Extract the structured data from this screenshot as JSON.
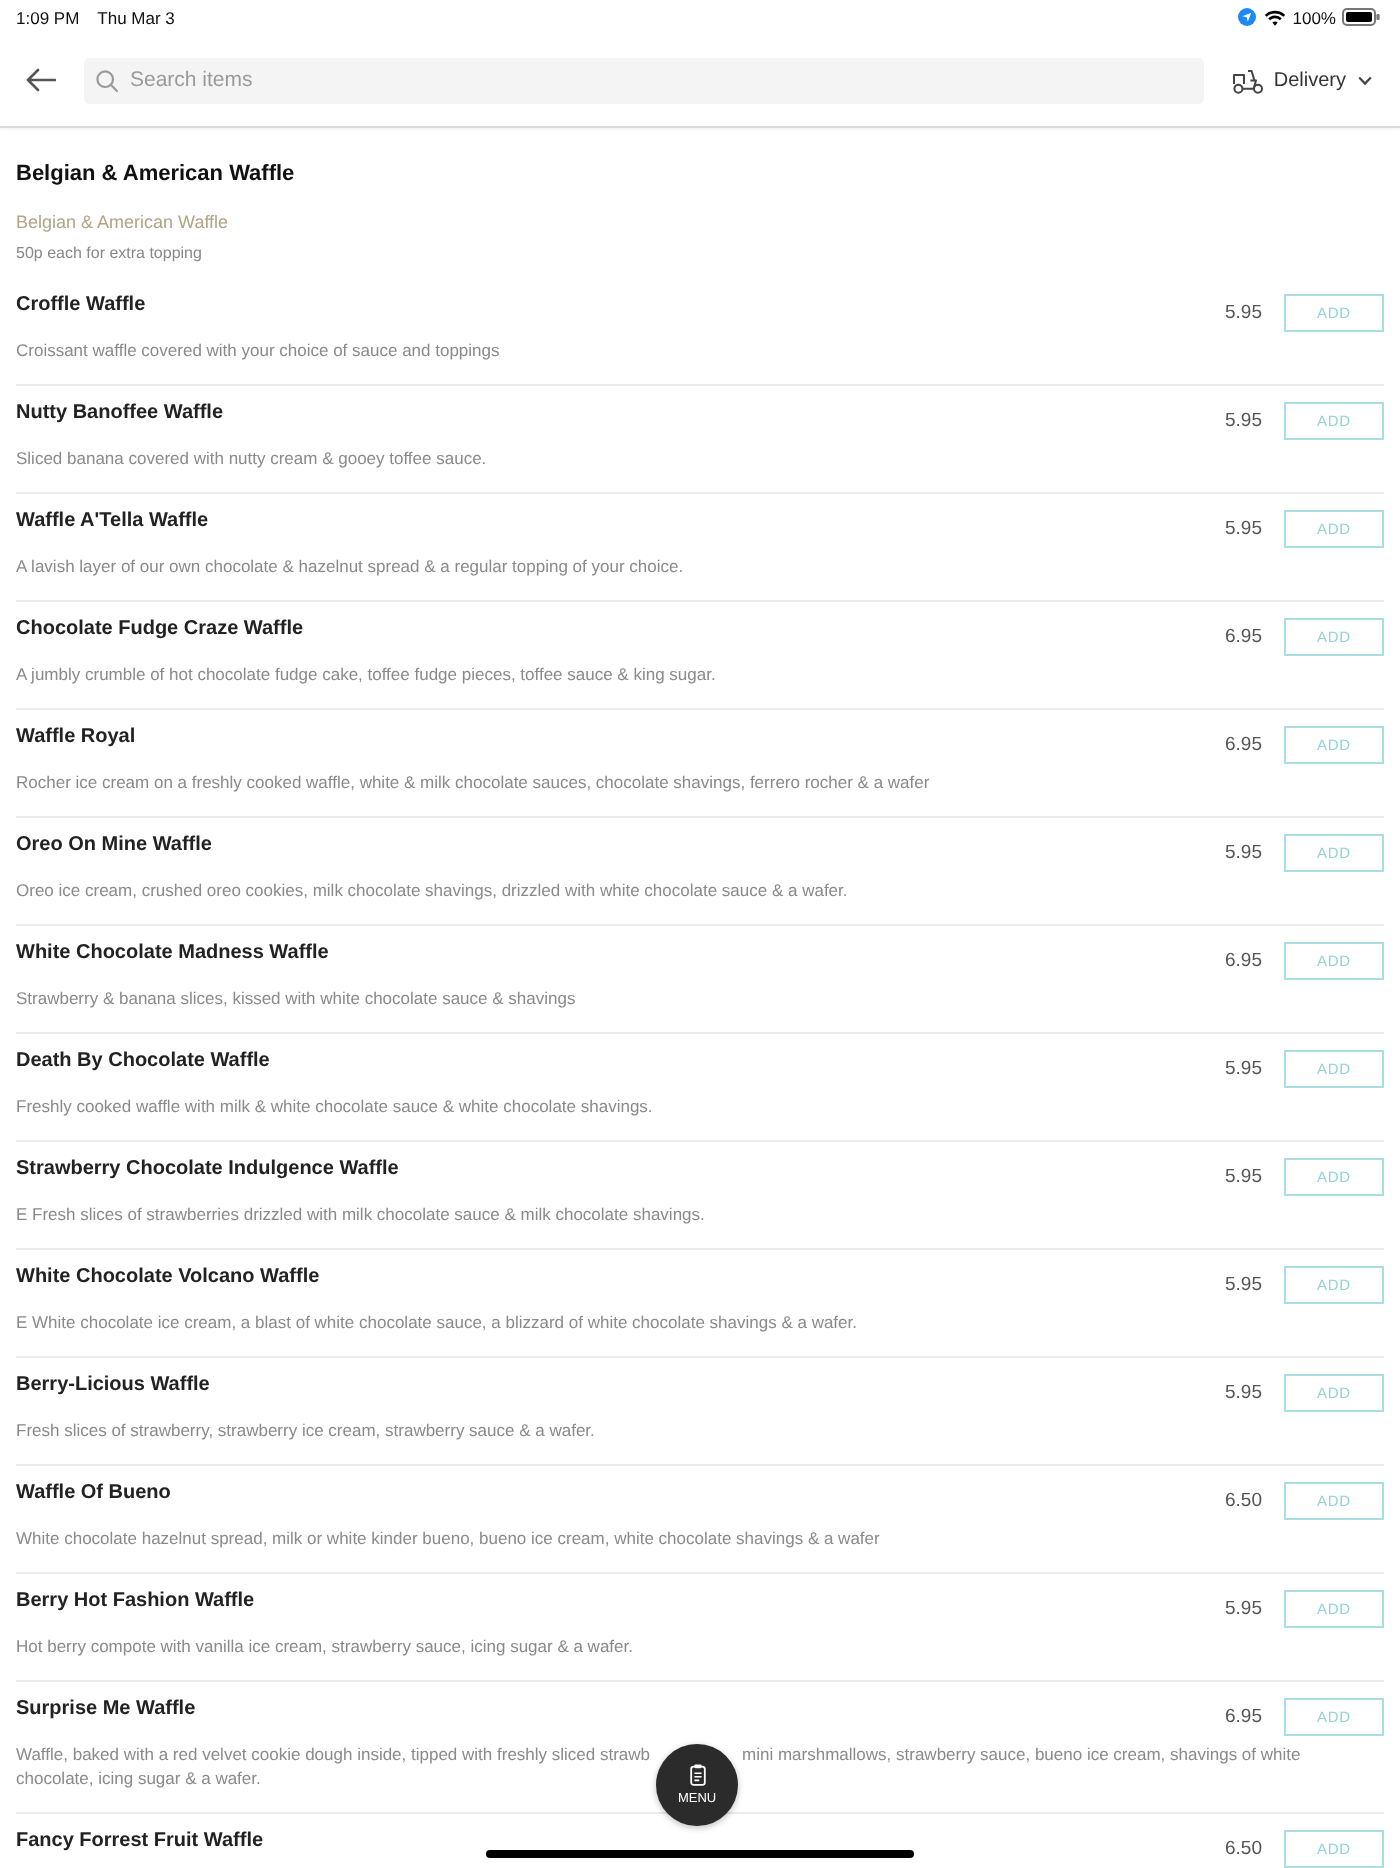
{
  "status_bar": {
    "time": "1:09 PM",
    "date": "Thu Mar 3",
    "battery": "100%"
  },
  "top_bar": {
    "search": {
      "placeholder": "Search items"
    },
    "order_mode": {
      "label": "Delivery"
    }
  },
  "section": {
    "title": "Belgian & American Waffle",
    "subtitle": "Belgian & American Waffle",
    "note": "50p each for extra topping"
  },
  "items": [
    {
      "name": "Croffle Waffle",
      "price": "5.95",
      "button": "ADD",
      "description": "Croissant waffle covered with your choice of sauce and toppings"
    },
    {
      "name": "Nutty Banoffee Waffle",
      "price": "5.95",
      "button": "ADD",
      "description": "Sliced banana covered with nutty cream & gooey toffee sauce."
    },
    {
      "name": "Waffle A'Tella Waffle",
      "price": "5.95",
      "button": "ADD",
      "description": "A lavish layer of our own chocolate & hazelnut spread & a regular topping of your choice."
    },
    {
      "name": "Chocolate Fudge Craze Waffle",
      "price": "6.95",
      "button": "ADD",
      "description": "A jumbly crumble of hot chocolate fudge cake, toffee fudge pieces, toffee sauce & king sugar."
    },
    {
      "name": "Waffle Royal",
      "price": "6.95",
      "button": "ADD",
      "description": "Rocher ice cream on a freshly cooked waffle, white & milk chocolate sauces, chocolate shavings, ferrero rocher & a wafer"
    },
    {
      "name": "Oreo On Mine Waffle",
      "price": "5.95",
      "button": "ADD",
      "description": "Oreo ice cream, crushed oreo cookies, milk chocolate shavings, drizzled with white chocolate sauce & a wafer."
    },
    {
      "name": "White Chocolate Madness Waffle",
      "price": "6.95",
      "button": "ADD",
      "description": "Strawberry & banana slices, kissed with white chocolate sauce & shavings"
    },
    {
      "name": "Death By Chocolate Waffle",
      "price": "5.95",
      "button": "ADD",
      "description": "Freshly cooked waffle with milk & white chocolate sauce & white chocolate shavings."
    },
    {
      "name": "Strawberry Chocolate Indulgence Waffle",
      "price": "5.95",
      "button": "ADD",
      "description": "E Fresh slices of strawberries drizzled with milk chocolate sauce & milk chocolate shavings."
    },
    {
      "name": "White Chocolate Volcano Waffle",
      "price": "5.95",
      "button": "ADD",
      "description": "E White chocolate ice cream, a blast of white chocolate sauce, a blizzard of white chocolate shavings & a wafer."
    },
    {
      "name": "Berry-Licious Waffle",
      "price": "5.95",
      "button": "ADD",
      "description": "Fresh slices of strawberry, strawberry ice cream, strawberry sauce & a wafer."
    },
    {
      "name": "Waffle Of Bueno",
      "price": "6.50",
      "button": "ADD",
      "description": "White chocolate hazelnut spread, milk or white kinder bueno, bueno ice cream, white chocolate shavings & a wafer"
    },
    {
      "name": "Berry Hot Fashion Waffle",
      "price": "5.95",
      "button": "ADD",
      "description": "Hot berry compote with vanilla ice cream, strawberry sauce, icing sugar & a wafer."
    },
    {
      "name": "Surprise Me Waffle",
      "price": "6.95",
      "button": "ADD",
      "description_lines": [
        [
          "Waffle, baked with a red velvet cookie dough inside, tipped with freshly sliced strawb",
          "mini marshmallows, strawberry sauce, bueno ice cream, shavings of white"
        ],
        [
          "chocolate, icing sugar & a wafer."
        ]
      ]
    },
    {
      "name": "Fancy Forrest Fruit Waffle",
      "price": "6.50",
      "button": "ADD"
    }
  ],
  "menu_button": {
    "label": "MENU"
  }
}
